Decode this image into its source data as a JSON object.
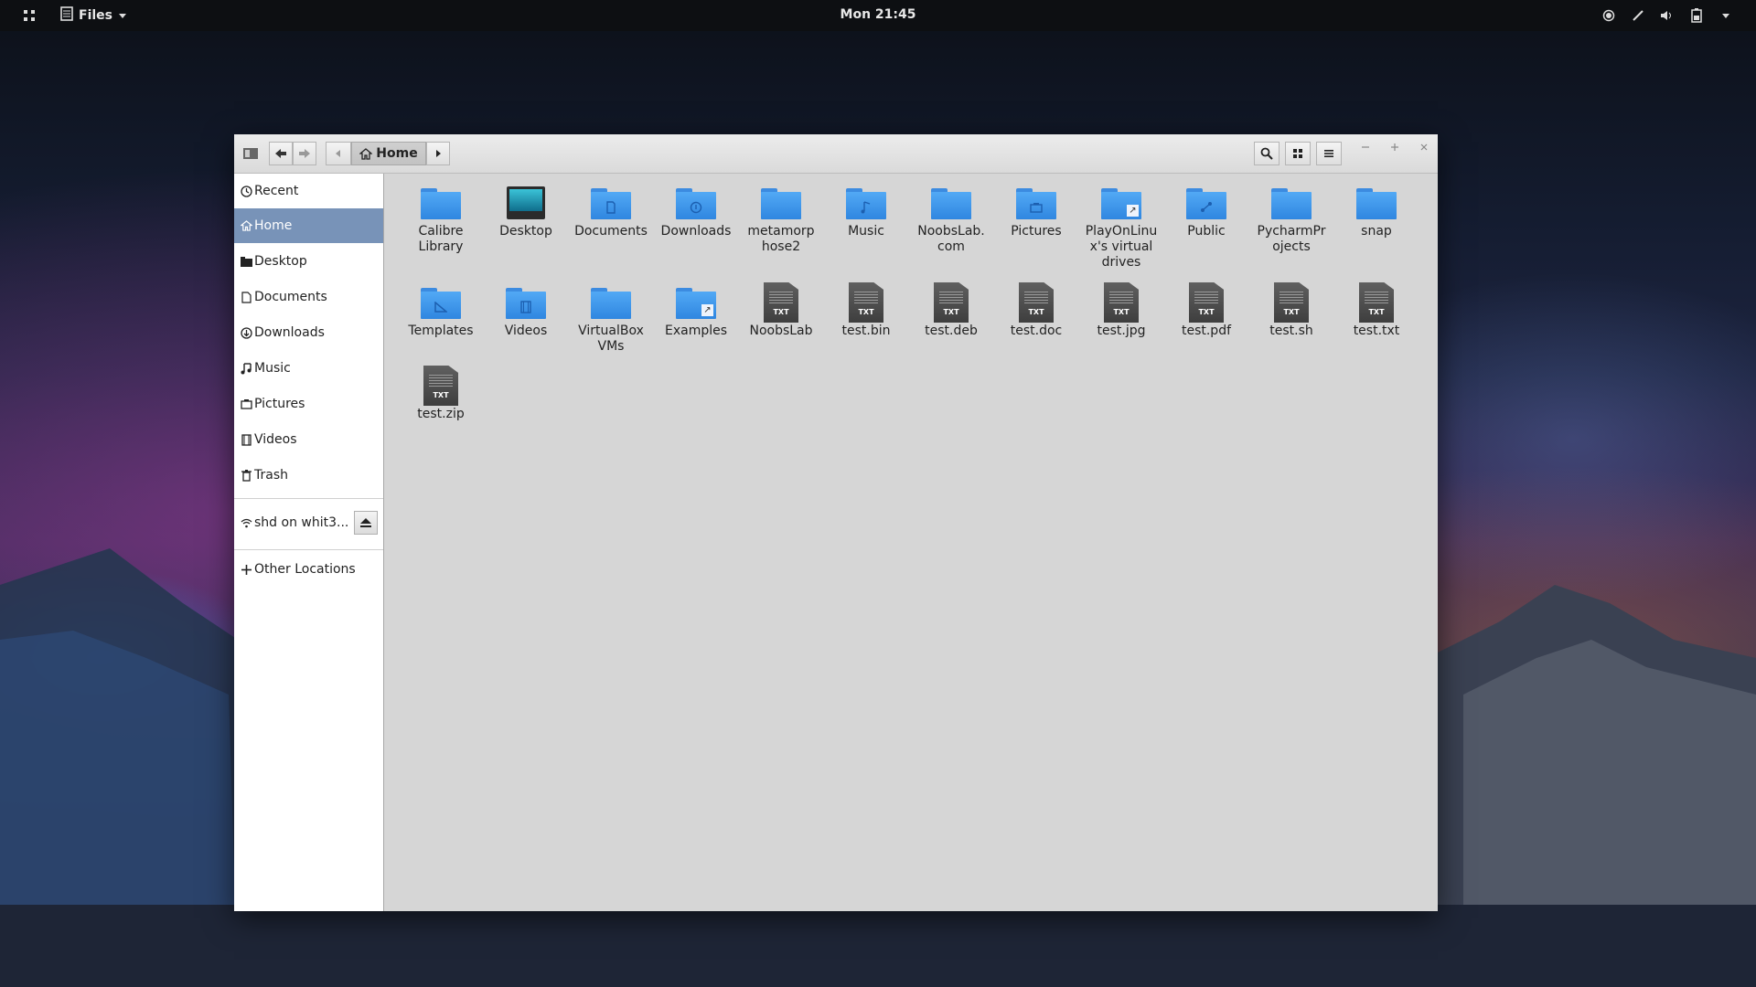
{
  "topbar": {
    "app_menu": "Files",
    "clock": "Mon 21:45"
  },
  "toolbar": {
    "breadcrumb_current": "Home"
  },
  "sidebar": {
    "places": [
      {
        "label": "Recent",
        "icon": "clock-icon"
      },
      {
        "label": "Home",
        "icon": "home-icon",
        "active": true
      },
      {
        "label": "Desktop",
        "icon": "desktop-folder-icon"
      },
      {
        "label": "Documents",
        "icon": "document-icon"
      },
      {
        "label": "Downloads",
        "icon": "download-icon"
      },
      {
        "label": "Music",
        "icon": "music-note-icon"
      },
      {
        "label": "Pictures",
        "icon": "picture-icon"
      },
      {
        "label": "Videos",
        "icon": "film-icon"
      },
      {
        "label": "Trash",
        "icon": "trash-icon"
      }
    ],
    "network": {
      "label": "shd on whit3...",
      "icon": "wifi-icon"
    },
    "other_locations": "Other Locations"
  },
  "files": [
    {
      "name": "Calibre\nLibrary",
      "kind": "folder"
    },
    {
      "name": "Desktop",
      "kind": "desktop"
    },
    {
      "name": "Documents",
      "kind": "folder",
      "emblem": "document"
    },
    {
      "name": "Downloads",
      "kind": "folder",
      "emblem": "download"
    },
    {
      "name": "metamorp\nhose2",
      "kind": "folder"
    },
    {
      "name": "Music",
      "kind": "folder",
      "emblem": "music"
    },
    {
      "name": "NoobsLab.\ncom",
      "kind": "folder"
    },
    {
      "name": "Pictures",
      "kind": "folder",
      "emblem": "picture"
    },
    {
      "name": "PlayOnLinu\nx's virtual\ndrives",
      "kind": "folder",
      "emblem": "link"
    },
    {
      "name": "Public",
      "kind": "folder",
      "emblem": "share"
    },
    {
      "name": "PycharmPr\nojects",
      "kind": "folder"
    },
    {
      "name": "snap",
      "kind": "folder"
    },
    {
      "name": "Templates",
      "kind": "folder",
      "emblem": "template"
    },
    {
      "name": "Videos",
      "kind": "folder",
      "emblem": "film"
    },
    {
      "name": "VirtualBox\nVMs",
      "kind": "folder"
    },
    {
      "name": "Examples",
      "kind": "folder",
      "emblem": "link"
    },
    {
      "name": "NoobsLab",
      "kind": "file",
      "badge": "TXT"
    },
    {
      "name": "test.bin",
      "kind": "file",
      "badge": "TXT"
    },
    {
      "name": "test.deb",
      "kind": "file",
      "badge": "TXT"
    },
    {
      "name": "test.doc",
      "kind": "file",
      "badge": "TXT"
    },
    {
      "name": "test.jpg",
      "kind": "file",
      "badge": "TXT"
    },
    {
      "name": "test.pdf",
      "kind": "file",
      "badge": "TXT"
    },
    {
      "name": "test.sh",
      "kind": "file",
      "badge": "TXT"
    },
    {
      "name": "test.txt",
      "kind": "file",
      "badge": "TXT"
    },
    {
      "name": "test.zip",
      "kind": "file",
      "badge": "TXT"
    }
  ],
  "colors": {
    "folder": "#3b93ea",
    "sidebar_active": "#7893b8",
    "content_bg": "#d6d6d6"
  }
}
